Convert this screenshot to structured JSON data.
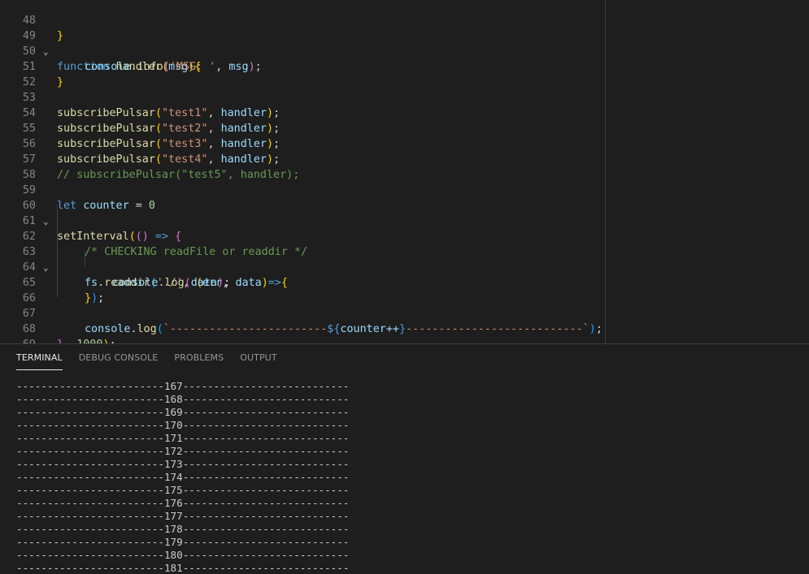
{
  "editor": {
    "line_numbers": [
      "48",
      "49",
      "50",
      "51",
      "52",
      "53",
      "54",
      "55",
      "56",
      "57",
      "58",
      "59",
      "60",
      "61",
      "62",
      "63",
      "64",
      "65",
      "66",
      "67",
      "68",
      "69"
    ],
    "lines": {
      "l48": {
        "brace": "}"
      },
      "l49": {
        "kw": "function",
        "name": "handler",
        "open": "(",
        "param": "msg",
        "close": ")",
        "brace": "{"
      },
      "l50": {
        "obj": "console",
        "dot": ".",
        "method": "info",
        "open": "(",
        "str": "'MSG: '",
        "comma": ", ",
        "arg": "msg",
        "close": ")",
        "semi": ";"
      },
      "l51": {
        "brace": "}"
      },
      "l53": {
        "fn": "subscribePulsar",
        "open": "(",
        "str": "\"test1\"",
        "comma": ", ",
        "arg": "handler",
        "close": ")",
        "semi": ";"
      },
      "l54": {
        "fn": "subscribePulsar",
        "open": "(",
        "str": "\"test2\"",
        "comma": ", ",
        "arg": "handler",
        "close": ")",
        "semi": ";"
      },
      "l55": {
        "fn": "subscribePulsar",
        "open": "(",
        "str": "\"test3\"",
        "comma": ", ",
        "arg": "handler",
        "close": ")",
        "semi": ";"
      },
      "l56": {
        "fn": "subscribePulsar",
        "open": "(",
        "str": "\"test4\"",
        "comma": ", ",
        "arg": "handler",
        "close": ")",
        "semi": ";"
      },
      "l57": {
        "comment": "// subscribePulsar(\"test5\", handler);"
      },
      "l59": {
        "kw": "let",
        "var": "counter",
        "op": " = ",
        "num": "0"
      },
      "l60": {
        "fn": "setInterval",
        "open": "(",
        "open2": "()",
        "arrow": " => ",
        "brace": "{"
      },
      "l62": {
        "comment": "/* CHECKING readFile or readdir */"
      },
      "l63": {
        "obj": "fs",
        "dot": ".",
        "method": "readdir",
        "open": "(",
        "str": "'./'",
        "comma": ", ",
        "popen": "(",
        "p1": "err",
        "pcomma": ", ",
        "p2": "data",
        "pclose": ")",
        "arrow": "=>",
        "brace": "{"
      },
      "l64": {
        "obj": "console",
        "dot": ".",
        "method": "log",
        "open": "(",
        "arg": "data",
        "close": ")",
        "semi": ";"
      },
      "l65": {
        "brace": "}",
        "close": ")",
        "semi": ";"
      },
      "l67": {
        "obj": "console",
        "dot": ".",
        "method": "log",
        "open": "(",
        "str1": "`------------------------",
        "interp_open": "${",
        "interp": "counter++",
        "interp_close": "}",
        "str2": "---------------------------`",
        "close": ")",
        "semi": ";"
      },
      "l68": {
        "brace": "}",
        "comma": ", ",
        "num": "1000",
        "close": ")",
        "semi": ";"
      }
    }
  },
  "panel": {
    "tabs": [
      "TERMINAL",
      "DEBUG CONSOLE",
      "PROBLEMS",
      "OUTPUT"
    ],
    "active_tab": "TERMINAL",
    "terminal_lines": [
      "------------------------167---------------------------",
      "------------------------168---------------------------",
      "------------------------169---------------------------",
      "------------------------170---------------------------",
      "------------------------171---------------------------",
      "------------------------172---------------------------",
      "------------------------173---------------------------",
      "------------------------174---------------------------",
      "------------------------175---------------------------",
      "------------------------176---------------------------",
      "------------------------177---------------------------",
      "------------------------178---------------------------",
      "------------------------179---------------------------",
      "------------------------180---------------------------",
      "------------------------181---------------------------"
    ]
  },
  "colors": {
    "background": "#1e1e1e",
    "keyword": "#569cd6",
    "function": "#dcdcaa",
    "variable": "#9cdcfe",
    "string": "#ce9178",
    "comment": "#6a9955",
    "number": "#b5cea8"
  },
  "icons": {
    "fold": "chevron-down-icon"
  }
}
